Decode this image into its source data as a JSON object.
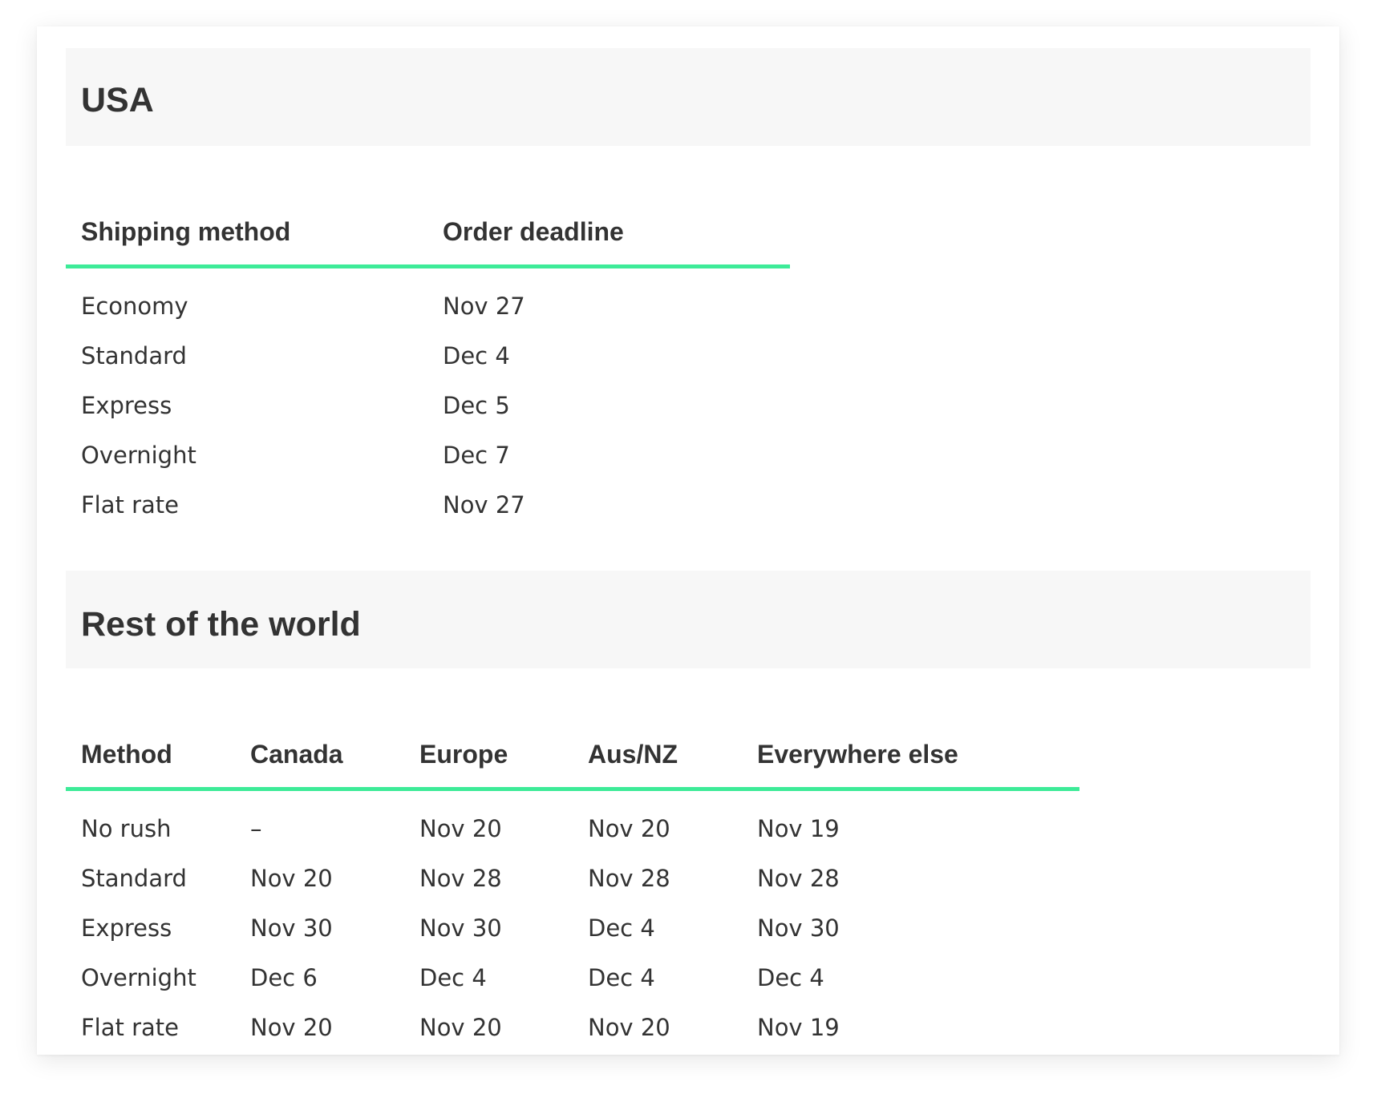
{
  "colors": {
    "accent_underline": "#3deb98",
    "section_header_bg": "#f7f7f7",
    "text": "#333333"
  },
  "usa": {
    "title": "USA",
    "headers": [
      "Shipping method",
      "Order deadline"
    ],
    "rows": [
      [
        "Economy",
        "Nov 27"
      ],
      [
        "Standard",
        "Dec 4"
      ],
      [
        "Express",
        "Dec 5"
      ],
      [
        "Overnight",
        "Dec 7"
      ],
      [
        "Flat rate",
        "Nov 27"
      ]
    ]
  },
  "rest_of_world": {
    "title": "Rest of the world",
    "headers": [
      "Method",
      "Canada",
      "Europe",
      "Aus/NZ",
      "Everywhere else"
    ],
    "rows": [
      [
        "No rush",
        "–",
        "Nov 20",
        "Nov 20",
        "Nov 19"
      ],
      [
        "Standard",
        "Nov 20",
        "Nov 28",
        "Nov 28",
        "Nov 28"
      ],
      [
        "Express",
        "Nov 30",
        "Nov 30",
        "Dec 4",
        "Nov 30"
      ],
      [
        "Overnight",
        "Dec 6",
        "Dec 4",
        "Dec 4",
        "Dec 4"
      ],
      [
        "Flat rate",
        "Nov 20",
        "Nov 20",
        "Nov 20",
        "Nov 19"
      ]
    ]
  }
}
